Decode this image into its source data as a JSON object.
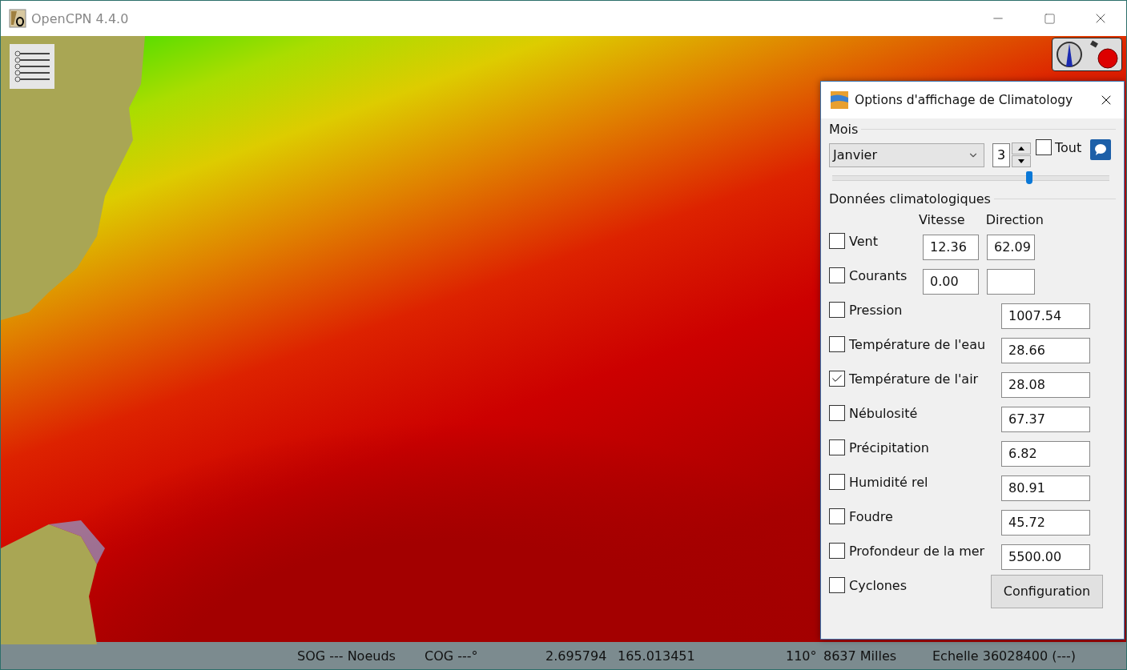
{
  "window": {
    "title": "OpenCPN 4.4.0"
  },
  "dialog": {
    "title": "Options d'affichage de Climatology",
    "month_group": {
      "label": "Mois",
      "month": "Janvier",
      "number": "3",
      "all": {
        "label": "Tout",
        "checked": false
      },
      "slider": {
        "level": 0.71
      }
    },
    "data_group": {
      "label": "Données climatologiques",
      "headers": [
        "Vitesse",
        "Direction"
      ],
      "rows": [
        {
          "kind": "pair",
          "label": "Vent",
          "checked": false,
          "speed": "12.36",
          "direction": "62.09"
        },
        {
          "kind": "pair",
          "label": "Courants",
          "checked": false,
          "speed": "0.00"
        },
        {
          "kind": "single",
          "label": "Pression",
          "checked": false,
          "value": "1007.54"
        },
        {
          "kind": "single",
          "label": "Température de l'eau",
          "checked": false,
          "value": "28.66"
        },
        {
          "kind": "single",
          "label": "Température de l'air",
          "checked": true,
          "value": "28.08"
        },
        {
          "kind": "single",
          "label": "Nébulosité",
          "checked": false,
          "value": "67.37"
        },
        {
          "kind": "single",
          "label": "Précipitation",
          "checked": false,
          "value": "6.82"
        },
        {
          "kind": "single",
          "label": "Humidité rel",
          "checked": false,
          "value": "80.91"
        },
        {
          "kind": "single",
          "label": "Foudre",
          "checked": false,
          "value": "45.72"
        },
        {
          "kind": "single",
          "label": "Profondeur de la mer",
          "checked": false,
          "value": "5500.00"
        },
        {
          "kind": "button",
          "label": "Cyclones",
          "checked": false,
          "button": "Configuration"
        }
      ]
    }
  },
  "status_bar": [
    "SOG --- Noeuds",
    "COG ---°",
    "2.695794",
    "165.013451",
    "110°",
    "8637 Milles",
    "Echelle 36028400 (---)"
  ]
}
